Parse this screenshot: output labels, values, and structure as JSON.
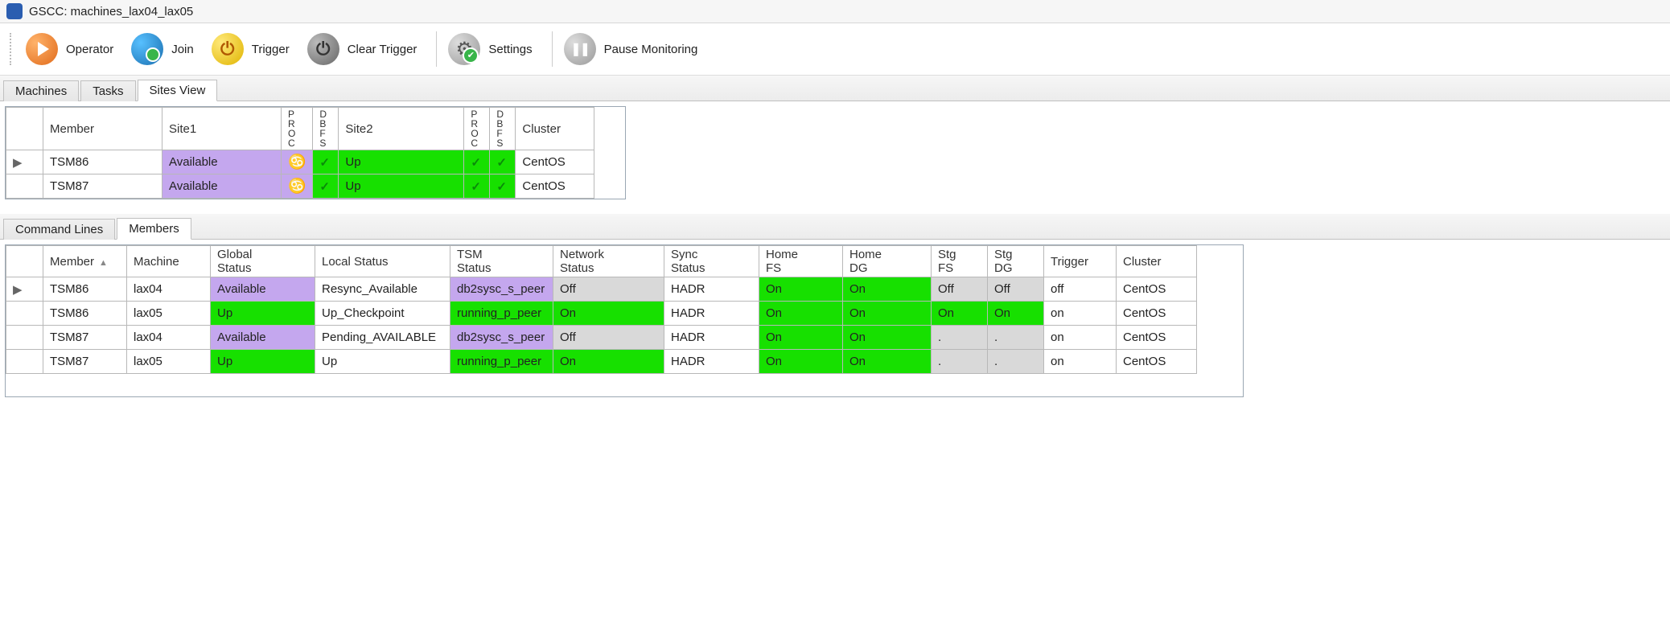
{
  "window": {
    "title": "GSCC: machines_lax04_lax05"
  },
  "toolbar": {
    "operator": "Operator",
    "join": "Join",
    "trigger": "Trigger",
    "clear_trigger": "Clear Trigger",
    "settings": "Settings",
    "pause_monitoring": "Pause Monitoring"
  },
  "tabs_top": {
    "machines": "Machines",
    "tasks": "Tasks",
    "sites_view": "Sites View"
  },
  "sites_grid": {
    "headers": {
      "member": "Member",
      "site1": "Site1",
      "proc": "PROC",
      "dbfs": "DBFS",
      "site2": "Site2",
      "cluster": "Cluster"
    },
    "rows": [
      {
        "member": "TSM86",
        "site1": "Available",
        "proc1": "♋",
        "dbfs1": "✓",
        "site2": "Up",
        "proc2": "✓",
        "dbfs2": "✓",
        "cluster": "CentOS"
      },
      {
        "member": "TSM87",
        "site1": "Available",
        "proc1": "♋",
        "dbfs1": "✓",
        "site2": "Up",
        "proc2": "✓",
        "dbfs2": "✓",
        "cluster": "CentOS"
      }
    ]
  },
  "tabs_bottom": {
    "command_lines": "Command Lines",
    "members": "Members"
  },
  "members_grid": {
    "headers": {
      "member": "Member",
      "machine": "Machine",
      "global_status": "Global Status",
      "local_status": "Local Status",
      "tsm_status": "TSM Status",
      "network_status": "Network Status",
      "sync_status": "Sync Status",
      "home_fs": "Home FS",
      "home_dg": "Home DG",
      "stg_fs": "Stg FS",
      "stg_dg": "Stg DG",
      "trigger": "Trigger",
      "cluster": "Cluster"
    },
    "rows": [
      {
        "member": "TSM86",
        "machine": "lax04",
        "global": "Available",
        "global_cls": "purple",
        "local": "Resync_Available",
        "tsm": "db2sysc_s_peer",
        "tsm_cls": "purple",
        "net": "Off",
        "net_cls": "grey",
        "sync": "HADR",
        "hfs": "On",
        "hfs_cls": "green",
        "hdg": "On",
        "hdg_cls": "green",
        "sfs": "Off",
        "sfs_cls": "grey",
        "sdg": "Off",
        "sdg_cls": "grey",
        "trigger": "off",
        "cluster": "CentOS",
        "rowmark": "▶"
      },
      {
        "member": "TSM86",
        "machine": "lax05",
        "global": "Up",
        "global_cls": "green",
        "local": "Up_Checkpoint",
        "tsm": "running_p_peer",
        "tsm_cls": "green",
        "net": "On",
        "net_cls": "green",
        "sync": "HADR",
        "hfs": "On",
        "hfs_cls": "green",
        "hdg": "On",
        "hdg_cls": "green",
        "sfs": "On",
        "sfs_cls": "green",
        "sdg": "On",
        "sdg_cls": "green",
        "trigger": "on",
        "cluster": "CentOS",
        "rowmark": ""
      },
      {
        "member": "TSM87",
        "machine": "lax04",
        "global": "Available",
        "global_cls": "purple",
        "local": "Pending_AVAILABLE",
        "tsm": "db2sysc_s_peer",
        "tsm_cls": "purple",
        "net": "Off",
        "net_cls": "grey",
        "sync": "HADR",
        "hfs": "On",
        "hfs_cls": "green",
        "hdg": "On",
        "hdg_cls": "green",
        "sfs": ".",
        "sfs_cls": "grey",
        "sdg": ".",
        "sdg_cls": "grey",
        "trigger": "on",
        "cluster": "CentOS",
        "rowmark": ""
      },
      {
        "member": "TSM87",
        "machine": "lax05",
        "global": "Up",
        "global_cls": "green",
        "local": "Up",
        "tsm": "running_p_peer",
        "tsm_cls": "green",
        "net": "On",
        "net_cls": "green",
        "sync": "HADR",
        "hfs": "On",
        "hfs_cls": "green",
        "hdg": "On",
        "hdg_cls": "green",
        "sfs": ".",
        "sfs_cls": "grey",
        "sdg": ".",
        "sdg_cls": "grey",
        "trigger": "on",
        "cluster": "CentOS",
        "rowmark": ""
      }
    ]
  }
}
